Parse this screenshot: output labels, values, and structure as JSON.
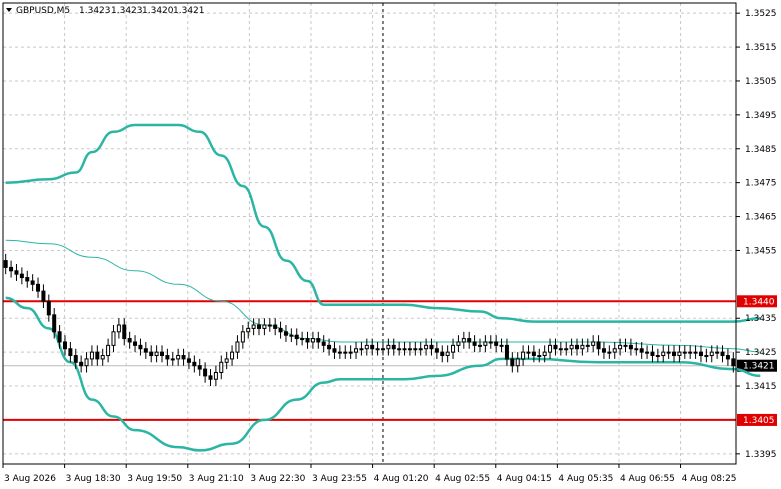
{
  "header": {
    "symbol": "GBPUSD,M5",
    "open": "1.3423",
    "high": "1.3423",
    "low": "1.3420",
    "close": "1.3421",
    "menu_icon": "triangle-down-icon"
  },
  "colors": {
    "background": "#ffffff",
    "grid": "#c8c8c8",
    "bollinger": "#2bb5a3",
    "level": "#e00000",
    "candle": "#000000",
    "current_price_box": "#000000"
  },
  "chart_data": {
    "type": "candlestick",
    "symbol": "GBPUSD",
    "timeframe": "M5",
    "ylim": [
      1.3392,
      1.3528
    ],
    "y_ticks": [
      1.3525,
      1.3515,
      1.3505,
      1.3495,
      1.3485,
      1.3475,
      1.3465,
      1.3455,
      1.3435,
      1.3425,
      1.3415,
      1.3395
    ],
    "y_tick_labels": [
      "1.3525",
      "1.3515",
      "1.3505",
      "1.3495",
      "1.3485",
      "1.3475",
      "1.3465",
      "1.3455",
      "1.3435",
      "1.3425",
      "1.3415",
      "1.3395"
    ],
    "x_tick_labels": [
      "3 Aug 2026",
      "3 Aug 18:30",
      "3 Aug 19:50",
      "3 Aug 21:10",
      "3 Aug 22:30",
      "3 Aug 23:55",
      "4 Aug 01:20",
      "4 Aug 02:55",
      "4 Aug 04:15",
      "4 Aug 05:35",
      "4 Aug 06:55",
      "4 Aug 08:25"
    ],
    "grid": true,
    "horizontal_levels": [
      {
        "price": 1.344,
        "label": "1.3440"
      },
      {
        "price": 1.3405,
        "label": "1.3405"
      }
    ],
    "current_price": {
      "price": 1.3421,
      "label": "1.3421"
    },
    "candles_close": [
      1.345,
      1.3449,
      1.3448,
      1.3447,
      1.3446,
      1.3445,
      1.3443,
      1.344,
      1.3436,
      1.3431,
      1.3428,
      1.3426,
      1.3424,
      1.3422,
      1.3421,
      1.3423,
      1.3425,
      1.3423,
      1.3424,
      1.3427,
      1.3431,
      1.3433,
      1.3429,
      1.3428,
      1.3427,
      1.3426,
      1.3425,
      1.3424,
      1.3425,
      1.3424,
      1.3423,
      1.3423,
      1.3424,
      1.3423,
      1.3422,
      1.3421,
      1.342,
      1.3418,
      1.3417,
      1.3419,
      1.3422,
      1.3423,
      1.3425,
      1.3428,
      1.3431,
      1.3432,
      1.3433,
      1.3432,
      1.3433,
      1.3433,
      1.3432,
      1.3431,
      1.343,
      1.343,
      1.3429,
      1.3429,
      1.3428,
      1.3429,
      1.3428,
      1.3427,
      1.3426,
      1.3425,
      1.3425,
      1.3425,
      1.3425,
      1.3426,
      1.3426,
      1.3427,
      1.3426,
      1.3426,
      1.3426,
      1.3427,
      1.3426,
      1.3426,
      1.3426,
      1.3426,
      1.3426,
      1.3426,
      1.3427,
      1.3426,
      1.3425,
      1.3424,
      1.3425,
      1.3427,
      1.3428,
      1.3429,
      1.3428,
      1.3427,
      1.3427,
      1.3428,
      1.3428,
      1.3427,
      1.3427,
      1.3423,
      1.3421,
      1.3423,
      1.3425,
      1.3425,
      1.3424,
      1.3424,
      1.3425,
      1.3427,
      1.3426,
      1.3426,
      1.3426,
      1.3427,
      1.3426,
      1.3427,
      1.3427,
      1.3428,
      1.3426,
      1.3425,
      1.3425,
      1.3426,
      1.3427,
      1.3427,
      1.3426,
      1.3426,
      1.3425,
      1.3425,
      1.3424,
      1.3424,
      1.3425,
      1.3425,
      1.3424,
      1.3425,
      1.3425,
      1.3425,
      1.3425,
      1.3424,
      1.3424,
      1.3425,
      1.3425,
      1.3424,
      1.3423,
      1.3421
    ],
    "bollinger": {
      "upper": [
        [
          0,
          1.3475
        ],
        [
          8,
          1.3476
        ],
        [
          13,
          1.3478
        ],
        [
          16,
          1.3484
        ],
        [
          20,
          1.349
        ],
        [
          24,
          1.3492
        ],
        [
          32,
          1.3492
        ],
        [
          36,
          1.349
        ],
        [
          40,
          1.3483
        ],
        [
          44,
          1.3474
        ],
        [
          48,
          1.3462
        ],
        [
          52,
          1.3452
        ],
        [
          56,
          1.3446
        ],
        [
          59,
          1.3439
        ],
        [
          62,
          1.3439
        ],
        [
          74,
          1.3439
        ],
        [
          80,
          1.3438
        ],
        [
          88,
          1.3437
        ],
        [
          92,
          1.3435
        ],
        [
          98,
          1.3434
        ],
        [
          110,
          1.3434
        ],
        [
          125,
          1.3434
        ],
        [
          135,
          1.3434
        ],
        [
          140,
          1.3435
        ]
      ],
      "middle": [
        [
          0,
          1.3458
        ],
        [
          8,
          1.3457
        ],
        [
          16,
          1.3453
        ],
        [
          24,
          1.3449
        ],
        [
          32,
          1.3445
        ],
        [
          40,
          1.344
        ],
        [
          48,
          1.3433
        ],
        [
          56,
          1.3429
        ],
        [
          62,
          1.3428
        ],
        [
          74,
          1.3428
        ],
        [
          88,
          1.3428
        ],
        [
          98,
          1.3428
        ],
        [
          110,
          1.3428
        ],
        [
          125,
          1.3427
        ],
        [
          135,
          1.3426
        ],
        [
          140,
          1.3425
        ]
      ],
      "lower": [
        [
          0,
          1.3441
        ],
        [
          4,
          1.3438
        ],
        [
          8,
          1.3432
        ],
        [
          12,
          1.3422
        ],
        [
          16,
          1.3411
        ],
        [
          20,
          1.3406
        ],
        [
          24,
          1.3402
        ],
        [
          32,
          1.3397
        ],
        [
          36,
          1.3396
        ],
        [
          42,
          1.3398
        ],
        [
          48,
          1.3405
        ],
        [
          54,
          1.3411
        ],
        [
          59,
          1.3416
        ],
        [
          62,
          1.3417
        ],
        [
          74,
          1.3417
        ],
        [
          80,
          1.3418
        ],
        [
          88,
          1.3421
        ],
        [
          92,
          1.3423
        ],
        [
          98,
          1.3423
        ],
        [
          110,
          1.3422
        ],
        [
          125,
          1.3422
        ],
        [
          135,
          1.342
        ],
        [
          140,
          1.3418
        ]
      ]
    },
    "vertical_marker_index": 70
  }
}
